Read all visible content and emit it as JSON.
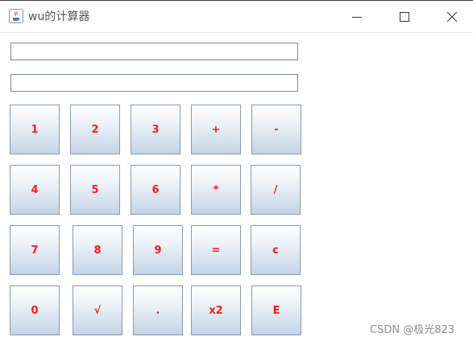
{
  "window": {
    "title": "wu的计算器",
    "app_icon": "java-coffee-cup-icon",
    "controls": [
      "minimize-icon",
      "maximize-icon",
      "close-icon"
    ]
  },
  "fields": {
    "display_1": {
      "value": ""
    },
    "display_2": {
      "value": ""
    }
  },
  "keypad": {
    "rows": [
      [
        "1",
        "2",
        "3",
        "+",
        "-"
      ],
      [
        "4",
        "5",
        "6",
        "*",
        "/"
      ],
      [
        "7",
        "8",
        "9",
        "=",
        "c"
      ],
      [
        "0",
        "√",
        ".",
        "x2",
        "E"
      ]
    ]
  },
  "colors": {
    "key_text": "#ff1a1a",
    "key_gradient_top": "#ffffff",
    "key_gradient_bottom": "#c3d4e6",
    "key_border": "#8a9aac",
    "field_border": "#7a8a99"
  },
  "watermark": "CSDN @极光823"
}
